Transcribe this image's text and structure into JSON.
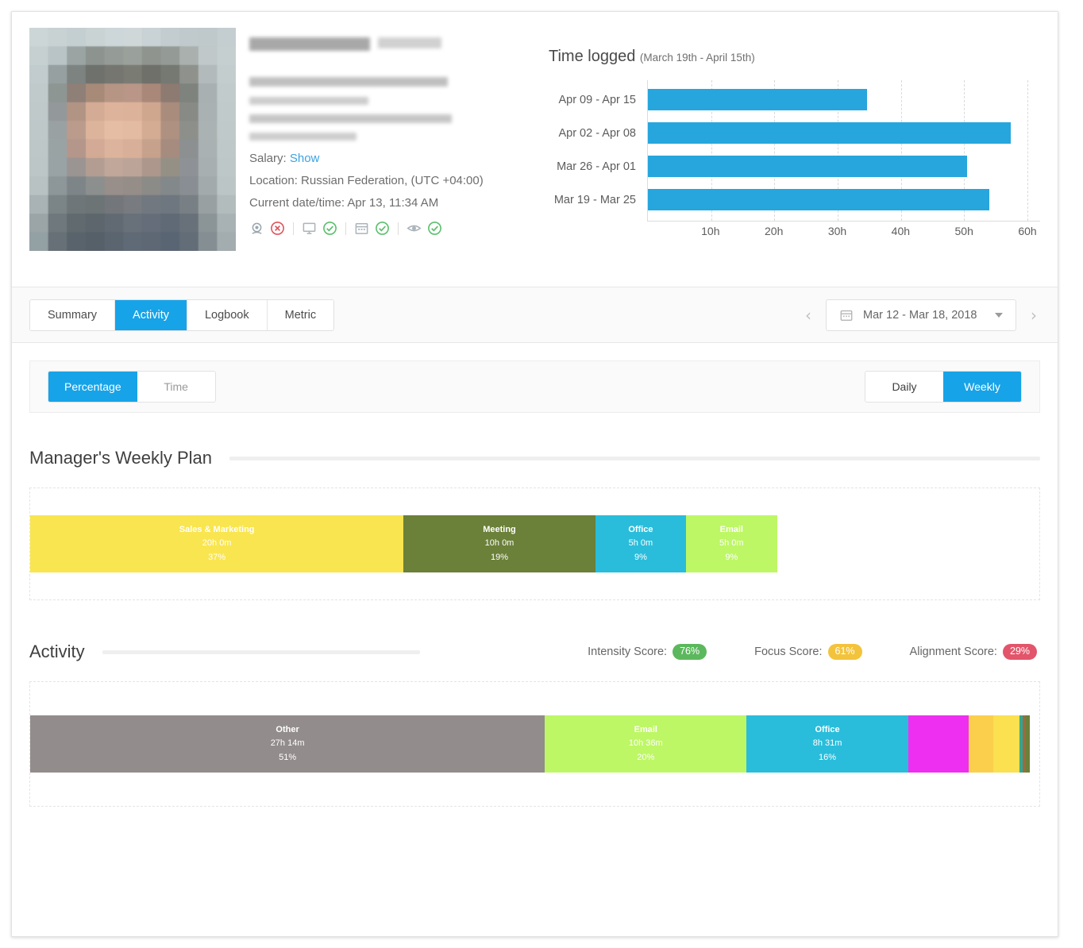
{
  "profile": {
    "salary_label": "Salary:",
    "salary_link": "Show",
    "location_line": "Location: Russian Federation, (UTC +04:00)",
    "datetime_line": "Current date/time: Apr 13, 11:34 AM",
    "icons": [
      {
        "name": "webcam-icon",
        "status": "error"
      },
      {
        "name": "monitor-icon",
        "status": "ok"
      },
      {
        "name": "calendar-icon",
        "status": "ok"
      },
      {
        "name": "eye-icon",
        "status": "ok"
      }
    ]
  },
  "time_logged": {
    "title": "Time logged",
    "subtitle": "(March 19th - April 15th)"
  },
  "tabs": [
    {
      "label": "Summary",
      "active": false
    },
    {
      "label": "Activity",
      "active": true
    },
    {
      "label": "Logbook",
      "active": false
    },
    {
      "label": "Metric",
      "active": false
    }
  ],
  "date_nav": {
    "prev": "‹",
    "next": "›",
    "value": "Mar 12 - Mar 18, 2018"
  },
  "view_toggle": {
    "options": [
      "Percentage",
      "Time"
    ],
    "selected": "Percentage"
  },
  "period_toggle": {
    "options": [
      "Daily",
      "Weekly"
    ],
    "selected": "Weekly"
  },
  "plan_section": {
    "title": "Manager's Weekly Plan"
  },
  "activity_section": {
    "title": "Activity",
    "scores": [
      {
        "label": "Intensity Score:",
        "value": "76%",
        "color": "#5cb85c"
      },
      {
        "label": "Focus Score:",
        "value": "61%",
        "color": "#f3c33c"
      },
      {
        "label": "Alignment Score:",
        "value": "29%",
        "color": "#e2556a"
      }
    ]
  },
  "chart_data": [
    {
      "type": "bar",
      "orientation": "horizontal",
      "title": "Time logged",
      "subtitle": "(March 19th - April 15th)",
      "categories": [
        "Apr 09 - Apr 15",
        "Apr 02 - Apr 08",
        "Mar 26 - Apr 01",
        "Mar 19 - Mar 25"
      ],
      "values": [
        34.7,
        57.3,
        50.5,
        54.0
      ],
      "unit": "h",
      "xlabel": "",
      "ylabel": "",
      "xlim": [
        0,
        62
      ],
      "xticks": [
        10,
        20,
        30,
        40,
        50,
        60
      ],
      "xtick_labels": [
        "10h",
        "20h",
        "30h",
        "40h",
        "50h",
        "60h"
      ],
      "grid": true,
      "legend": false,
      "bar_color": "#26a6dd"
    },
    {
      "type": "bar",
      "subtype": "stacked-single",
      "title": "Manager's Weekly Plan",
      "segments": [
        {
          "name": "Sales & Marketing",
          "time": "20h 0m",
          "pct": "37%",
          "value": 37,
          "color": "#f9e54f",
          "label_color": "#ffffff"
        },
        {
          "name": "Meeting",
          "time": "10h 0m",
          "pct": "19%",
          "value": 19,
          "color": "#6b8039",
          "label_color": "#ffffff"
        },
        {
          "name": "Office",
          "time": "5h 0m",
          "pct": "9%",
          "value": 9,
          "color": "#29bddb",
          "label_color": "#ffffff"
        },
        {
          "name": "Email",
          "time": "5h 0m",
          "pct": "9%",
          "value": 9,
          "color": "#bdf765",
          "label_color": "#ffffff"
        }
      ],
      "total_pct": 74
    },
    {
      "type": "bar",
      "subtype": "stacked-single",
      "title": "Activity",
      "segments": [
        {
          "name": "Other",
          "time": "27h 14m",
          "pct": "51%",
          "value": 51,
          "color": "#938c8c",
          "label_color": "#ffffff"
        },
        {
          "name": "Email",
          "time": "10h 36m",
          "pct": "20%",
          "value": 20,
          "color": "#bdf765",
          "label_color": "#ffffff"
        },
        {
          "name": "Office",
          "time": "8h 31m",
          "pct": "16%",
          "value": 16,
          "color": "#29bddb",
          "label_color": "#ffffff"
        },
        {
          "name": "",
          "time": "",
          "pct": "",
          "value": 6,
          "color": "#ee2ff2",
          "label_color": "#ffffff"
        },
        {
          "name": "",
          "time": "",
          "pct": "",
          "value": 2.4,
          "color": "#fbcf4b",
          "label_color": "#ffffff"
        },
        {
          "name": "",
          "time": "",
          "pct": "",
          "value": 2.6,
          "color": "#fbe04f",
          "label_color": "#ffffff"
        },
        {
          "name": "",
          "time": "",
          "pct": "",
          "value": 0.35,
          "color": "#33a58f",
          "label_color": "#ffffff"
        },
        {
          "name": "",
          "time": "",
          "pct": "",
          "value": 0.35,
          "color": "#9c6b3f",
          "label_color": "#ffffff"
        },
        {
          "name": "",
          "time": "",
          "pct": "",
          "value": 0.35,
          "color": "#6b8039",
          "label_color": "#ffffff"
        }
      ],
      "total_pct": 99.05
    }
  ]
}
